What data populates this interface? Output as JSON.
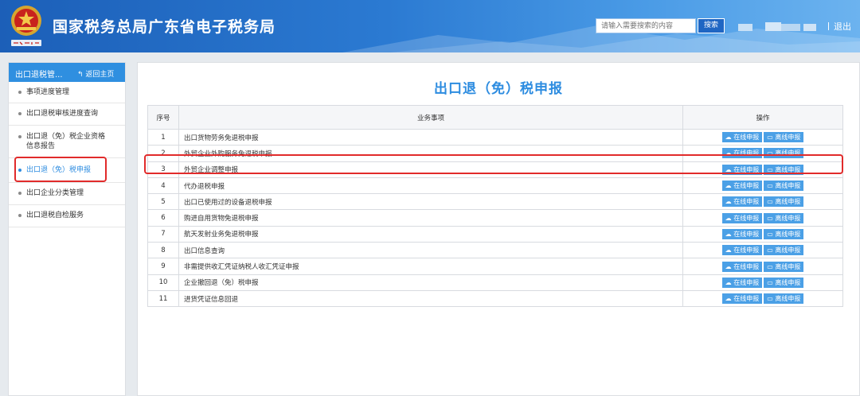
{
  "header": {
    "title": "国家税务总局广东省电子税务局",
    "emblem_caption": "中国税务",
    "search_placeholder": "请输入需要搜索的内容",
    "search_button": "搜索",
    "logout": "退出"
  },
  "sidebar": {
    "title": "出口退税管...",
    "back": "返回主页",
    "items": [
      {
        "label": "事项进度管理"
      },
      {
        "label": "出口退税审核进度查询"
      },
      {
        "label_line1": "出口退（免）税企业资格",
        "label_line2": "信息报告"
      },
      {
        "label": "出口退（免）税申报"
      },
      {
        "label": "出口企业分类管理"
      },
      {
        "label": "出口退税自检服务"
      }
    ]
  },
  "main": {
    "title": "出口退（免）税申报",
    "columns": [
      "序号",
      "业务事项",
      "操作"
    ],
    "online_label": "在线申报",
    "offline_label": "离线申报",
    "rows": [
      {
        "no": "1",
        "item": "出口货物劳务免退税申报"
      },
      {
        "no": "2",
        "item": "外贸企业外购服务免退税申报"
      },
      {
        "no": "3",
        "item": "外贸企业调整申报"
      },
      {
        "no": "4",
        "item": "代办退税申报"
      },
      {
        "no": "5",
        "item": "出口已使用过的设备退税申报"
      },
      {
        "no": "6",
        "item": "购进自用货物免退税申报"
      },
      {
        "no": "7",
        "item": "航天发射业务免退税申报"
      },
      {
        "no": "8",
        "item": "出口信息查询"
      },
      {
        "no": "9",
        "item": "非需提供收汇凭证纳税人收汇凭证申报"
      },
      {
        "no": "10",
        "item": "企业撤回退（免）税申报"
      },
      {
        "no": "11",
        "item": "进货凭证信息回退"
      }
    ]
  },
  "colors": {
    "header_blue": "#1c5fb8",
    "accent": "#2d8ce0",
    "button": "#4ba0e6",
    "highlight_border": "#e12b2b"
  }
}
